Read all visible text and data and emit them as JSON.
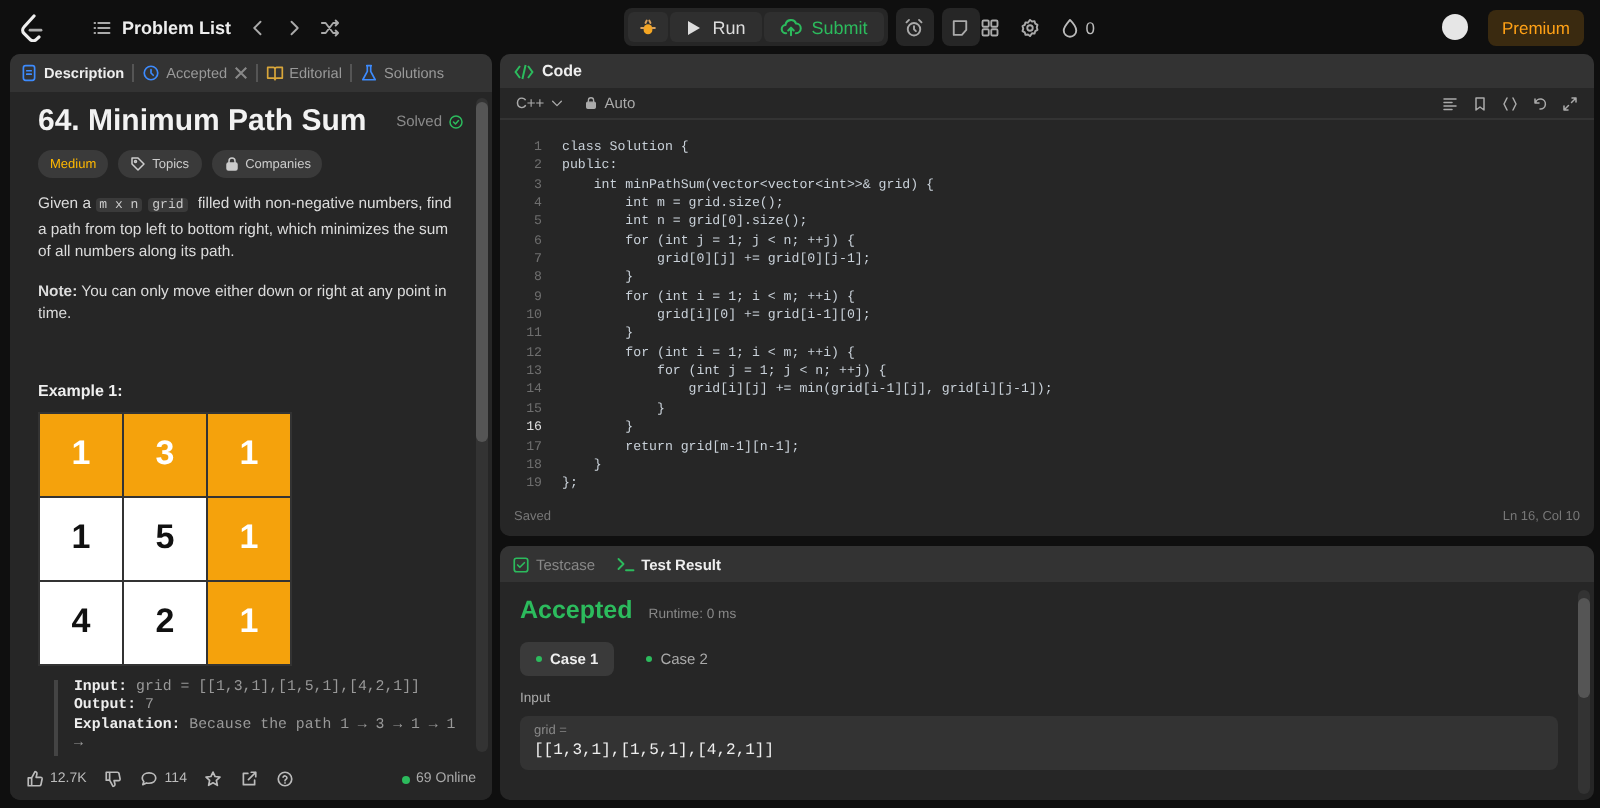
{
  "topbar": {
    "problem_list": "Problem List",
    "run": "Run",
    "submit": "Submit",
    "streak": "0",
    "premium": "Premium"
  },
  "description": {
    "tabs": [
      {
        "label": "Description",
        "kind": "doc",
        "selected": true,
        "closable": false
      },
      {
        "label": "Accepted",
        "kind": "history",
        "selected": false,
        "closable": true
      },
      {
        "label": "Editorial",
        "kind": "book",
        "selected": false,
        "closable": false
      },
      {
        "label": "Solutions",
        "kind": "flask",
        "selected": false,
        "closable": false
      }
    ],
    "title": "64. Minimum Path Sum",
    "status": "Solved",
    "difficulty": "Medium",
    "tags": [
      {
        "label": "Topics",
        "kind": "tag"
      },
      {
        "label": "Companies",
        "kind": "lock"
      }
    ],
    "statement": [
      {
        "kind": "text",
        "text": "Given a "
      },
      {
        "kind": "code",
        "text": "m x n"
      },
      {
        "kind": "code",
        "text": "grid"
      },
      {
        "kind": "text",
        "text": " filled with non-negative numbers, find a path from top left to bottom right, which minimizes the sum of all numbers along its path."
      }
    ],
    "note": "**Note:** You can only move either down or right at any point in time.",
    "example_title": "Example 1:",
    "grid": [
      [
        {
          "value": "1",
          "on_path": true
        },
        {
          "value": "3",
          "on_path": true
        },
        {
          "value": "1",
          "on_path": true
        }
      ],
      [
        {
          "value": "1",
          "on_path": false
        },
        {
          "value": "5",
          "on_path": false
        },
        {
          "value": "1",
          "on_path": true
        }
      ],
      [
        {
          "value": "4",
          "on_path": false
        },
        {
          "value": "2",
          "on_path": false
        },
        {
          "value": "1",
          "on_path": true
        }
      ]
    ],
    "example_lines": [
      "**Input:** grid = [[1,3,1],[1,5,1],[4,2,1]]",
      "**Output:** 7",
      "**Explanation:** Because the path 1 → 3 → 1 → 1 →"
    ],
    "footer": {
      "likes": "12.7K",
      "comments": "114",
      "online": "69 Online"
    }
  },
  "code": {
    "title": "Code",
    "language": "C++",
    "mode": "Auto",
    "lines": [
      {
        "number": "1",
        "text": "class Solution {",
        "current": false
      },
      {
        "number": "2",
        "text": "public:",
        "current": false
      },
      {
        "number": "3",
        "text": "    int minPathSum(vector<vector<int>>& grid) {",
        "current": false
      },
      {
        "number": "4",
        "text": "        int m = grid.size();",
        "current": false
      },
      {
        "number": "5",
        "text": "        int n = grid[0].size();",
        "current": false
      },
      {
        "number": "6",
        "text": "        for (int j = 1; j < n; ++j) {",
        "current": false
      },
      {
        "number": "7",
        "text": "            grid[0][j] += grid[0][j-1];",
        "current": false
      },
      {
        "number": "8",
        "text": "        }",
        "current": false
      },
      {
        "number": "9",
        "text": "        for (int i = 1; i < m; ++i) {",
        "current": false
      },
      {
        "number": "10",
        "text": "            grid[i][0] += grid[i-1][0];",
        "current": false
      },
      {
        "number": "11",
        "text": "        }",
        "current": false
      },
      {
        "number": "12",
        "text": "        for (int i = 1; i < m; ++i) {",
        "current": false
      },
      {
        "number": "13",
        "text": "            for (int j = 1; j < n; ++j) {",
        "current": false
      },
      {
        "number": "14",
        "text": "                grid[i][j] += min(grid[i-1][j], grid[i][j-1]);",
        "current": false
      },
      {
        "number": "15",
        "text": "            }",
        "current": false
      },
      {
        "number": "16",
        "text": "        }",
        "current": true
      },
      {
        "number": "17",
        "text": "        return grid[m-1][n-1];",
        "current": false
      },
      {
        "number": "18",
        "text": "    }",
        "current": false
      },
      {
        "number": "19",
        "text": "};",
        "current": false
      }
    ],
    "status": "Saved",
    "cursor": "Ln 16, Col 10"
  },
  "result": {
    "tabs": [
      {
        "label": "Testcase",
        "kind": "check",
        "selected": false
      },
      {
        "label": "Test Result",
        "kind": "terminal",
        "selected": true
      }
    ],
    "verdict": "Accepted",
    "runtime": "Runtime: 0 ms",
    "cases": [
      {
        "label": "Case 1",
        "selected": true,
        "passed": true
      },
      {
        "label": "Case 2",
        "selected": false,
        "passed": true
      }
    ],
    "input_label": "Input",
    "params": [
      {
        "name": "grid =",
        "value": "[[1,3,1],[1,5,1],[4,2,1]]"
      }
    ]
  }
}
